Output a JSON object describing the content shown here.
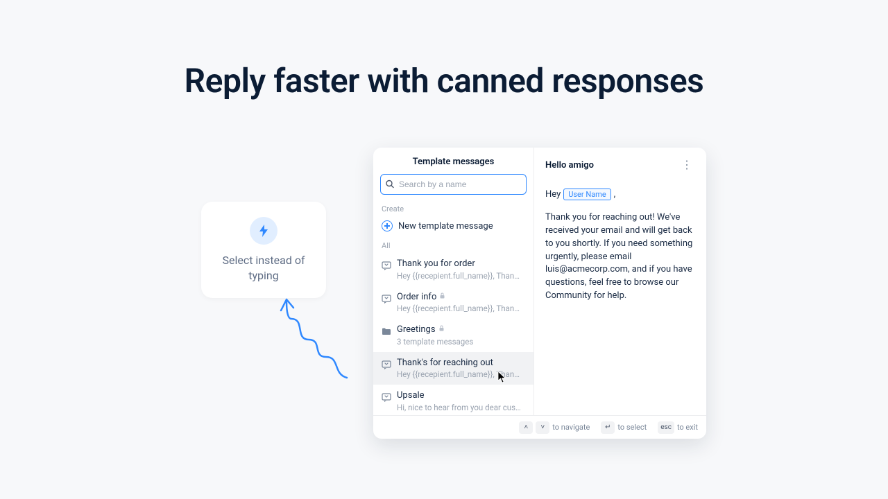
{
  "headline": "Reply faster with canned responses",
  "callout": {
    "text": "Select instead of typing"
  },
  "panel": {
    "left_title": "Template messages",
    "search_placeholder": "Search by a name",
    "section_create": "Create",
    "new_template": "New template message",
    "section_all": "All",
    "items": [
      {
        "title": "Thank you for order",
        "sub": "Hey {{recepient.full_name}}, Thank you for yo...",
        "locked": false,
        "type": "msg"
      },
      {
        "title": "Order info",
        "sub": "Hey {{recepient.full_name}}, Thank you for yo...",
        "locked": true,
        "type": "msg"
      },
      {
        "title": "Greetings",
        "sub": "3 template messages",
        "locked": true,
        "type": "folder"
      },
      {
        "title": "Thank's for reaching out",
        "sub": "Hey {{recepient.full_name}}, Thank you for yo...",
        "locked": false,
        "type": "msg",
        "selected": true
      },
      {
        "title": "Upsale",
        "sub": "Hi, nice to hear from you dear customer, how...",
        "locked": false,
        "type": "msg"
      }
    ]
  },
  "preview": {
    "title": "Hello amigo",
    "greet_prefix": "Hey",
    "chip": "User Name",
    "greet_suffix": ",",
    "body": "Thank you for reaching out! We've received your email and will get back to you shortly. If you need something urgently, please email luis@acmecorp.com, and if you have questions, feel free to browse our Community for help."
  },
  "footer": {
    "navigate": "to navigate",
    "select": "to select",
    "exit": "to exit",
    "esc": "esc"
  }
}
